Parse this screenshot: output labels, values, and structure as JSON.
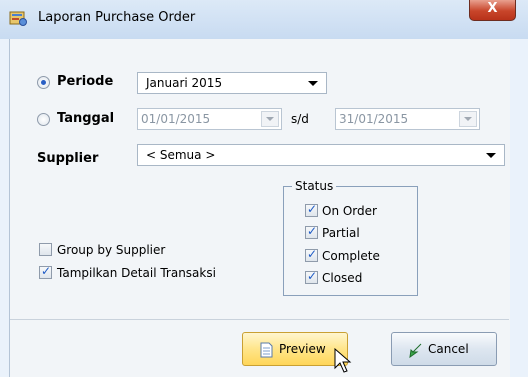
{
  "window": {
    "title": "Laporan Purchase Order",
    "close_label": "X"
  },
  "periode": {
    "label": "Periode",
    "selected": true,
    "value": "Januari 2015"
  },
  "tanggal": {
    "label": "Tanggal",
    "selected": false,
    "from": "01/01/2015",
    "separator": "s/d",
    "to": "31/01/2015"
  },
  "supplier": {
    "label": "Supplier",
    "value": "< Semua >"
  },
  "status": {
    "legend": "Status",
    "items": [
      {
        "label": "On Order",
        "checked": true
      },
      {
        "label": "Partial",
        "checked": true
      },
      {
        "label": "Complete",
        "checked": true
      },
      {
        "label": "Closed",
        "checked": true
      }
    ]
  },
  "options": {
    "group_by_supplier": {
      "label": "Group by Supplier",
      "checked": false
    },
    "show_detail": {
      "label": "Tampilkan Detail Transaksi",
      "checked": true
    }
  },
  "buttons": {
    "preview": "Preview",
    "cancel": "Cancel"
  },
  "colors": {
    "accent": "#2a5fc4",
    "preview_button": "#ffe58a",
    "close_button": "#c8452a"
  }
}
